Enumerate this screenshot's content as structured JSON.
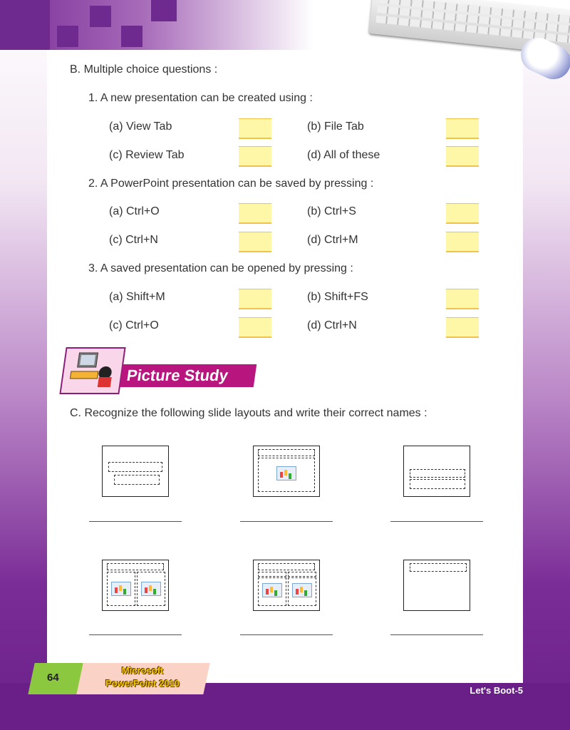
{
  "section_b": {
    "heading": "B.  Multiple choice questions :",
    "questions": [
      {
        "label": "1.  A new presentation can be created using :",
        "options": [
          "(a)  View Tab",
          "(b)  File Tab",
          "(c)  Review Tab",
          "(d)  All of these"
        ]
      },
      {
        "label": "2.  A PowerPoint presentation can be saved by pressing :",
        "options": [
          "(a)  Ctrl+O",
          "(b)  Ctrl+S",
          "(c)  Ctrl+N",
          "(d)  Ctrl+M"
        ]
      },
      {
        "label": "3.  A saved presentation can be opened by pressing :",
        "options": [
          "(a)  Shift+M",
          "(b)  Shift+FS",
          "(c)  Ctrl+O",
          "(d)  Ctrl+N"
        ]
      }
    ]
  },
  "picture_study": {
    "label": "Picture Study"
  },
  "section_c": {
    "heading": "C.  Recognize the following slide layouts and write their correct names :"
  },
  "footer": {
    "page_number": "64",
    "book_line1": "Microsoft",
    "book_line2": "PowerPoint 2010",
    "series": "Let's Boot-5"
  },
  "colors": {
    "accent_red": "#d7141f",
    "brand_purple": "#6a1f88",
    "answer_box": "#fff7a8"
  }
}
